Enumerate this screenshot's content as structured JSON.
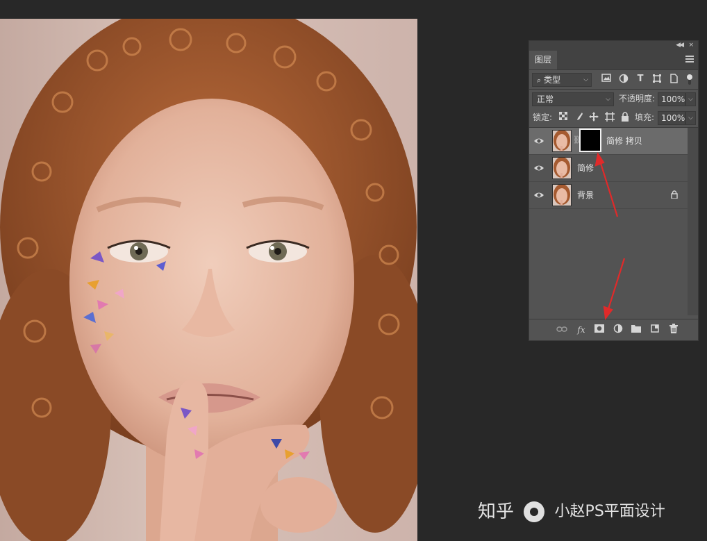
{
  "panel": {
    "tab_label": "图层",
    "filter": {
      "value": "类型",
      "search_icon": "search-icon"
    },
    "filter_icons": [
      "image-filter-icon",
      "adjustment-filter-icon",
      "type-filter-icon",
      "shape-filter-icon",
      "smart-object-filter-icon",
      "filter-toggle-icon"
    ],
    "blend_mode": "正常",
    "opacity_label": "不透明度:",
    "opacity_value": "100%",
    "lock_label": "锁定:",
    "lock_icons": [
      "lock-transparent-icon",
      "lock-image-icon",
      "lock-position-icon",
      "lock-artboard-icon",
      "lock-all-icon"
    ],
    "fill_label": "填充:",
    "fill_value": "100%",
    "layers": [
      {
        "name": "简修 拷贝",
        "visible": true,
        "has_mask": true,
        "selected": true
      },
      {
        "name": "简修",
        "visible": true,
        "has_mask": false,
        "selected": false
      },
      {
        "name": "背景",
        "visible": true,
        "has_mask": false,
        "selected": false,
        "locked": true
      }
    ],
    "footer_icons": [
      "link-layers-icon",
      "fx-icon",
      "add-mask-icon",
      "adjustment-layer-icon",
      "group-folder-icon",
      "new-layer-icon",
      "trash-icon"
    ],
    "fx_label": "fx"
  },
  "watermark": {
    "left": "知乎",
    "right": "小赵PS平面设计"
  },
  "colors": {
    "panel_bg": "#535353",
    "selected_row": "#6b6b6b",
    "annotation_arrow": "#e02a2a"
  }
}
